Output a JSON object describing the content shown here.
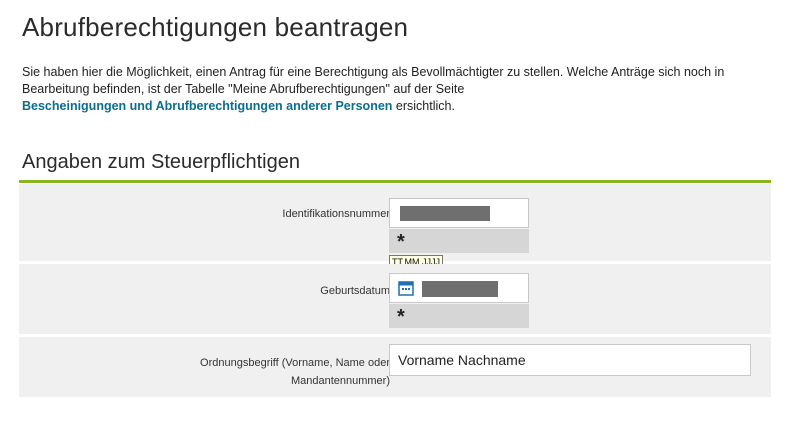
{
  "page": {
    "title": "Abrufberechtigungen beantragen",
    "intro_text_1": "Sie haben hier die Möglichkeit, einen Antrag für eine Berechtigung als Bevollmächtigter zu stellen. Welche Anträge sich noch in Bearbeitung befinden, ist der Tabelle \"Meine Abrufberechtigungen\" auf der Seite",
    "intro_link": "Bescheinigungen und Abrufberechtigungen anderer Personen",
    "intro_text_2": " ersichtlich."
  },
  "section": {
    "title": "Angaben zum Steuerpflichtigen",
    "accent_color": "#8ab521"
  },
  "form": {
    "id_label": "Identifikationsnummer",
    "id_required_marker": "*",
    "date_tooltip": "TT.MM.JJJJ",
    "birth_label": "Geburtsdatum",
    "birth_required_marker": "*",
    "calendar_icon": "calendar-icon",
    "order_label_line1": "Ordnungsbegriff (Vorname, Name oder",
    "order_label_line2": "Mandantennummer)",
    "order_placeholder": "Vorname Nachname"
  }
}
